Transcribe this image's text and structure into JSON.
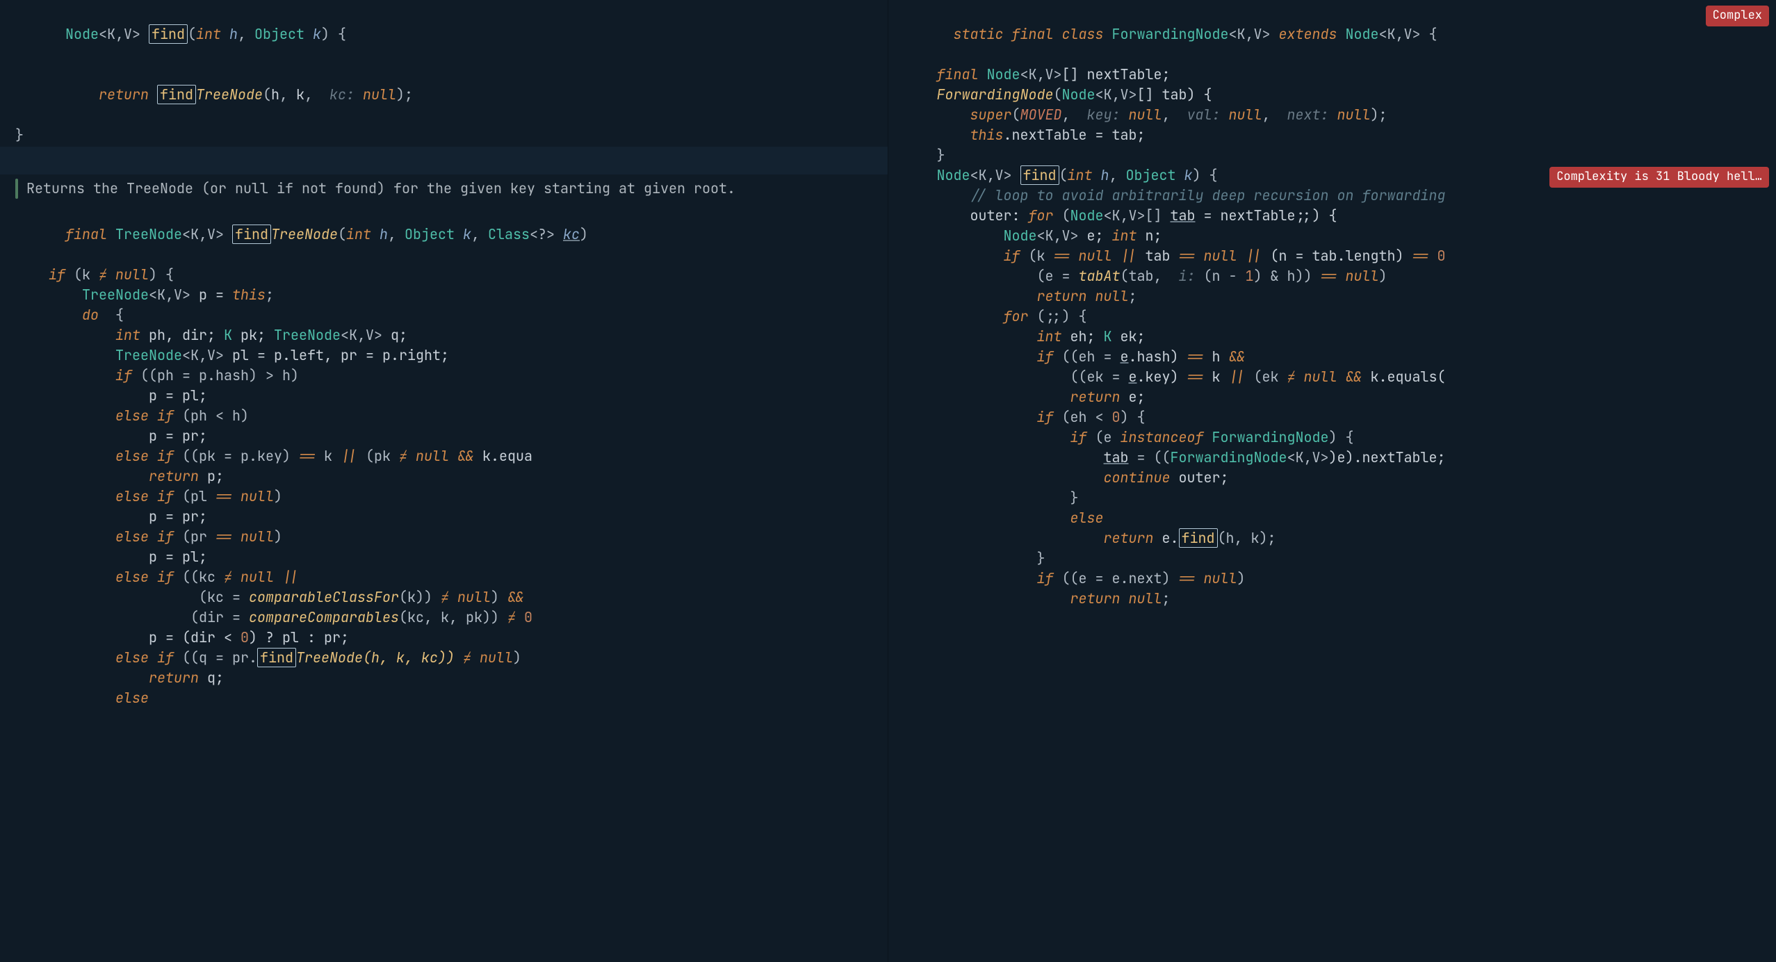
{
  "left": {
    "sig1": {
      "ret_ty": "Node",
      "ret_gen": "<K,V>",
      "sp": " ",
      "name": "find",
      "args_open": "(",
      "p1_ty": "int",
      "p1_nm": " h",
      "comma": ", ",
      "p2_ty": "Object",
      "p2_nm": " k",
      "args_close": ") {"
    },
    "ret1": {
      "ind": "    ",
      "kw": "return ",
      "name": "find",
      "tree": "TreeNode",
      "open": "(",
      "h": "h",
      "c1": ", ",
      "k": "k",
      "c2": ", ",
      "hint": " kc:",
      "sp": " ",
      "nul": "null",
      "close": ");"
    },
    "brace1": "}",
    "doc": "Returns the TreeNode (or null if not found) for the given key starting at given root.",
    "sig2": {
      "kw": "final ",
      "ret_ty": "TreeNode",
      "ret_gen": "<K,V>",
      "sp": " ",
      "name": "find",
      "tree": "TreeNode",
      "open": "(",
      "p1_ty": "int",
      "p1_nm": " h",
      "c1": ", ",
      "p2_ty": "Object",
      "p2_nm": " k",
      "c2": ", ",
      "p3_ty": "Class",
      "p3_gen": "<?>",
      "p3_nm": " ",
      "p3_var": "kc",
      "close": ")"
    },
    "l1": {
      "ind": "    ",
      "a": "if ",
      "b": "(k ",
      "ne": "≠",
      "c": " ",
      "nul": "null",
      "d": ") {"
    },
    "l2": {
      "ind": "        ",
      "ty": "TreeNode",
      "gen": "<K,V>",
      "a": " p = ",
      "th": "this",
      "b": ";"
    },
    "l3": {
      "ind": "        ",
      "a": "do ",
      "b": " {"
    },
    "l4": {
      "ind": "            ",
      "a": "int ",
      "b": "ph, dir; ",
      "c": "K ",
      "d": "pk; ",
      "e": "TreeNode",
      "gen": "<K,V>",
      "f": " q;"
    },
    "l5": {
      "ind": "            ",
      "ty": "TreeNode",
      "gen": "<K,V>",
      "a": " pl = p.left, pr = p.right;"
    },
    "l6": {
      "ind": "            ",
      "a": "if ",
      "b": "((ph = p.hash) > h)"
    },
    "l7": {
      "ind": "                ",
      "a": "p = pl;"
    },
    "l8": {
      "ind": "            ",
      "a": "else if ",
      "b": "(ph < h)"
    },
    "l9": {
      "ind": "                ",
      "a": "p = pr;"
    },
    "l10": {
      "ind": "            ",
      "a": "else if ",
      "b": "((pk = p.key) ",
      "eq": "==",
      "c": " k ",
      "or": "||",
      "d": " (pk ",
      "ne": "≠",
      "e": " ",
      "nul": "null",
      "f": " ",
      "and": "&&",
      "g": " k.equa"
    },
    "l11": {
      "ind": "                ",
      "a": "return ",
      "b": "p;"
    },
    "l12": {
      "ind": "            ",
      "a": "else if ",
      "b": "(pl ",
      "eq": "==",
      "c": " ",
      "nul": "null",
      "d": ")"
    },
    "l13": {
      "ind": "                ",
      "a": "p = pr;"
    },
    "l14": {
      "ind": "            ",
      "a": "else if ",
      "b": "(pr ",
      "eq": "==",
      "c": " ",
      "nul": "null",
      "d": ")"
    },
    "l15": {
      "ind": "                ",
      "a": "p = pl;"
    },
    "l16": {
      "ind": "            ",
      "a": "else if ",
      "b": "((kc ",
      "ne": "≠",
      "c": " ",
      "nul": "null",
      "d": " ",
      "or": "||"
    },
    "l17": {
      "ind": "                      ",
      "a": "(kc = ",
      "m": "comparableClassFor",
      "b": "(k)) ",
      "ne": "≠",
      "c": " ",
      "nul": "null",
      "d": ") ",
      "and": "&&"
    },
    "l18": {
      "ind": "                     ",
      "a": "(dir = ",
      "m": "compareComparables",
      "b": "(kc, k, pk)) ",
      "ne": "≠",
      "c": " ",
      "z": "0"
    },
    "l19": {
      "ind": "                ",
      "a": "p = (dir < ",
      "z": "0",
      "b": ") ? pl : pr;"
    },
    "l20": {
      "ind": "            ",
      "a": "else if ",
      "b": "((q = pr.",
      "name": "find",
      "tree": "TreeNode(h, k, kc)) ",
      "ne": "≠",
      "c": " ",
      "nul": "null",
      "d": ")"
    },
    "l21": {
      "ind": "                ",
      "a": "return ",
      "b": "q;"
    },
    "l22": {
      "ind": "            ",
      "a": "else"
    }
  },
  "right": {
    "badge1": "Complex",
    "badge2": "Complexity is 31 Bloody hell…",
    "r1": {
      "a": "static final class ",
      "ty": "ForwardingNode",
      "gen": "<K,V>",
      "b": " extends ",
      "ty2": "Node",
      "gen2": "<K,V>",
      "c": " {"
    },
    "r2": {
      "ind": "    ",
      "a": "final ",
      "ty": "Node",
      "gen": "<K,V>",
      "b": "[] nextTable;"
    },
    "r3": {
      "ind": "    ",
      "m": "ForwardingNode",
      "a": "(",
      "ty": "Node",
      "gen": "<K,V>",
      "b": "[] tab) {"
    },
    "r4": {
      "ind": "        ",
      "a": "super",
      "b": "(",
      "c": "MOVED",
      "d": ", ",
      "h1": " key:",
      "sp": " ",
      "nul": "null",
      "e": ", ",
      "h2": " val:",
      "nul2": "null",
      "f": ", ",
      "h3": " next:",
      "nul3": "null",
      "g": ");"
    },
    "r5": {
      "ind": "        ",
      "a": "this",
      "b": ".nextTable = tab;"
    },
    "r6": {
      "ind": "    ",
      "a": "}"
    },
    "r7": {
      "ind": ""
    },
    "r8": {
      "ind": "    ",
      "ty": "Node",
      "gen": "<K,V>",
      "sp": " ",
      "name": "find",
      "a": "(",
      "p1": "int",
      "p1n": " h",
      "c1": ", ",
      "p2": "Object",
      "p2n": " k",
      "b": ") {"
    },
    "r9": {
      "ind": "        ",
      "a": "// loop to avoid arbitrarily deep recursion on forwarding"
    },
    "r10": {
      "ind": "        ",
      "a": "outer: ",
      "b": "for ",
      "c": "(",
      "ty": "Node",
      "gen": "<K,V>",
      "d": "[] ",
      "tab": "tab",
      "e": " = nextTable;;) {"
    },
    "r11": {
      "ind": "            ",
      "ty": "Node",
      "gen": "<K,V>",
      "a": " e; ",
      "b": "int ",
      "c": "n;"
    },
    "r12": {
      "ind": "            ",
      "a": "if ",
      "b": "(k ",
      "eq": "==",
      "c": " ",
      "nul": "null",
      "d": " ",
      "or": "||",
      "e": " tab ",
      "eq2": "==",
      "f": " ",
      "nul2": "null",
      "g": " ",
      "or2": "||",
      "h": " (n = tab.length) ",
      "eq3": "==",
      "i": " ",
      "z": "0"
    },
    "r13": {
      "ind": "                ",
      "a": "(e = ",
      "m": "tabAt",
      "b": "(tab, ",
      "hint": " i:",
      "sp": " ",
      "c": "(n - ",
      "one": "1",
      "d": ") & h)) ",
      "eq": "==",
      "e": " ",
      "nul": "null",
      "f": ")"
    },
    "r14": {
      "ind": "                ",
      "a": "return ",
      "nul": "null",
      "b": ";"
    },
    "r15": {
      "ind": "            ",
      "a": "for ",
      "b": "(;;) {"
    },
    "r16": {
      "ind": "                ",
      "a": "int ",
      "b": "eh; ",
      "c": "K ",
      "d": "ek;"
    },
    "r17": {
      "ind": "                ",
      "a": "if ",
      "b": "((eh = ",
      "e": "e",
      "c": ".hash) ",
      "eq": "==",
      "d": " h ",
      "and": "&&"
    },
    "r18": {
      "ind": "                    ",
      "a": "((ek = ",
      "e": "e",
      "b": ".key) ",
      "eq": "==",
      "c": " k ",
      "or": "||",
      "d": " (ek ",
      "ne": "≠",
      "f": " ",
      "nul": "null",
      "g": " ",
      "and": "&&",
      "h": " k.equals("
    },
    "r19": {
      "ind": "                    ",
      "a": "return ",
      "b": "e;"
    },
    "r20": {
      "ind": "                ",
      "a": "if ",
      "b": "(eh < ",
      "z": "0",
      "c": ") {"
    },
    "r21": {
      "ind": "                    ",
      "a": "if ",
      "b": "(e ",
      "c": "instanceof ",
      "ty": "ForwardingNode",
      "d": ") {"
    },
    "r22": {
      "ind": "                        ",
      "tab": "tab",
      "a": " = ((",
      "ty": "ForwardingNode",
      "gen": "<K,V>",
      "b": ")e).nextTable;"
    },
    "r23": {
      "ind": "                        ",
      "a": "continue ",
      "b": "outer;"
    },
    "r24": {
      "ind": "                    ",
      "a": "}"
    },
    "r25": {
      "ind": "                    ",
      "a": "else"
    },
    "r26": {
      "ind": "                        ",
      "a": "return ",
      "b": "e.",
      "name": "find",
      "c": "(h, k);"
    },
    "r27": {
      "ind": "                ",
      "a": "}"
    },
    "r28": {
      "ind": "                ",
      "a": "if ",
      "b": "((e = e.next) ",
      "eq": "==",
      "c": " ",
      "nul": "null",
      "d": ")"
    },
    "r29": {
      "ind": "                    ",
      "a": "return ",
      "nul": "null",
      "b": ";"
    }
  }
}
